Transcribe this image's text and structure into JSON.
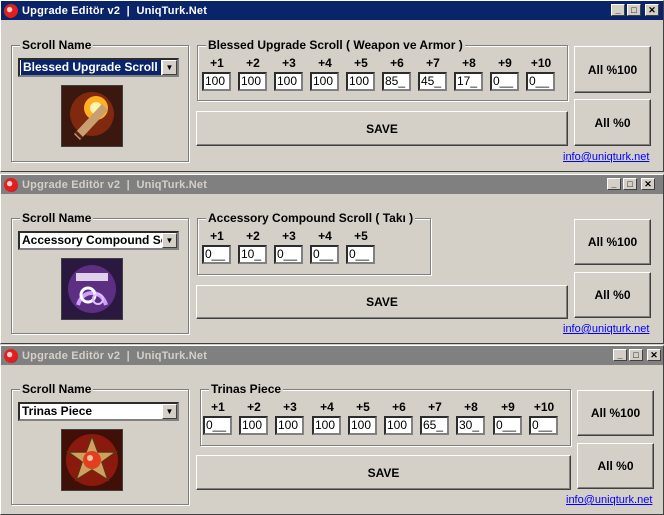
{
  "windows": [
    {
      "title": "Upgrade Editör v2  |  UniqTurk.Net",
      "active": true,
      "scroll_name_label": "Scroll Name",
      "selected_scroll": "Blessed Upgrade Scroll",
      "group_title": "Blessed Upgrade Scroll ( Weapon ve Armor )",
      "levels": [
        "+1",
        "+2",
        "+3",
        "+4",
        "+5",
        "+6",
        "+7",
        "+8",
        "+9",
        "+10"
      ],
      "values": [
        "100",
        "100",
        "100",
        "100",
        "100",
        "85_",
        "45_",
        "17_",
        "0__",
        "0__"
      ],
      "save_label": "SAVE",
      "all100_label": "All %100",
      "all0_label": "All %0",
      "email": "info@uniqturk.net"
    },
    {
      "title": "Upgrade Editör v2  |  UniqTurk.Net",
      "active": false,
      "scroll_name_label": "Scroll Name",
      "selected_scroll": "Accessory Compound Sc",
      "group_title": "Accessory Compound Scroll (  Takı )",
      "levels": [
        "+1",
        "+2",
        "+3",
        "+4",
        "+5"
      ],
      "values": [
        "0__",
        "10_",
        "0__",
        "0__",
        "0__"
      ],
      "save_label": "SAVE",
      "all100_label": "All %100",
      "all0_label": "All %0",
      "email": "info@uniqturk.net"
    },
    {
      "title": "Upgrade Editör v2  |  UniqTurk.Net",
      "active": false,
      "scroll_name_label": "Scroll Name",
      "selected_scroll": "Trinas Piece",
      "group_title": "Trinas Piece",
      "levels": [
        "+1",
        "+2",
        "+3",
        "+4",
        "+5",
        "+6",
        "+7",
        "+8",
        "+9",
        "+10"
      ],
      "values": [
        "0__",
        "100",
        "100",
        "100",
        "100",
        "100",
        "65_",
        "30_",
        "0__",
        "0__"
      ],
      "save_label": "SAVE",
      "all100_label": "All %100",
      "all0_label": "All %0",
      "email": "info@uniqturk.net"
    }
  ],
  "icons": {
    "app": "upgrade-app-icon",
    "minimize": "minimize-icon",
    "maximize": "maximize-icon",
    "close": "close-icon",
    "dropdown": "chevron-down-icon"
  }
}
